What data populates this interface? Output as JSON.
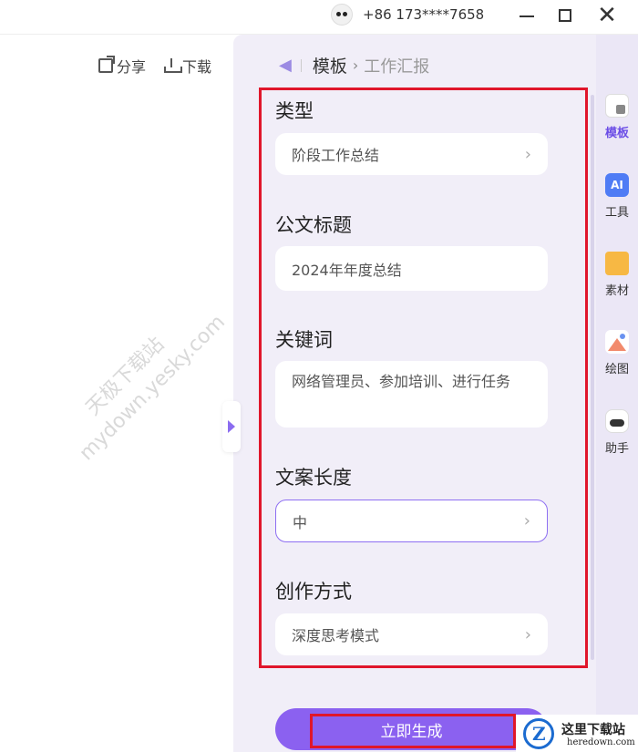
{
  "titlebar": {
    "phone": "+86 173****7658"
  },
  "doc_toolbar": {
    "share_label": "分享",
    "download_label": "下载"
  },
  "watermark": {
    "line1": "天极下载站",
    "line2": "mydown.yesky.com"
  },
  "breadcrumb": {
    "current": "模板",
    "sub": "工作汇报"
  },
  "form": {
    "type": {
      "label": "类型",
      "value": "阶段工作总结"
    },
    "title": {
      "label": "公文标题",
      "value": "2024年年度总结"
    },
    "keywords": {
      "label": "关键词",
      "value": "网络管理员、参加培训、进行任务"
    },
    "length": {
      "label": "文案长度",
      "value": "中"
    },
    "mode": {
      "label": "创作方式",
      "value": "深度思考模式"
    }
  },
  "generate_button": "立即生成",
  "sidebar": {
    "items": [
      {
        "label": "模板",
        "icon": "template-icon",
        "active": true
      },
      {
        "label": "工具",
        "icon": "ai-tools-icon",
        "icon_text": "AI",
        "active": false
      },
      {
        "label": "素材",
        "icon": "folder-icon",
        "active": false
      },
      {
        "label": "绘图",
        "icon": "drawing-icon",
        "active": false
      },
      {
        "label": "助手",
        "icon": "robot-icon",
        "active": false
      }
    ]
  },
  "site_logo": {
    "title": "这里下载站",
    "domain": "heredown.com"
  },
  "colors": {
    "accent": "#8b61f0",
    "panel_bg": "#f1eef8",
    "annotation_red": "#e0162b"
  }
}
